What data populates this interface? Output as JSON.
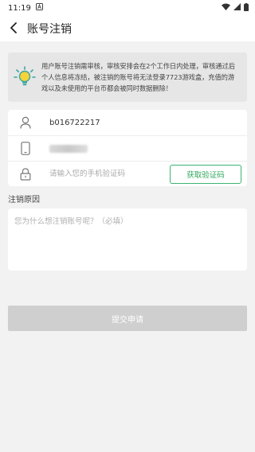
{
  "status_bar": {
    "time": "11:19",
    "notification_icon": "a-letter-icon",
    "wifi_icon": "wifi-icon",
    "signal_icon": "signal-icon",
    "battery_icon": "battery-icon"
  },
  "nav": {
    "back_icon": "chevron-left-icon",
    "title": "账号注销"
  },
  "notice": {
    "icon": "lightbulb-icon",
    "text": "用户账号注销需审核，审核安排会在2个工作日内处理，审核通过后个人信息将冻结，被注销的账号将无法登录7723游戏盒，充值的游戏以及未使用的平台币都会被同时数据删除！"
  },
  "form": {
    "account_icon": "user-icon",
    "account_value": "b016722217",
    "phone_icon": "phone-icon",
    "code_icon": "lock-icon",
    "code_placeholder": "请输入您的手机验证码",
    "code_button_label": "获取验证码"
  },
  "reason": {
    "label": "注销原因",
    "placeholder": "您为什么想注销账号呢？（必填）"
  },
  "submit": {
    "label": "提交申请"
  },
  "colors": {
    "accent_green": "#2ea85c",
    "submit_disabled": "#cfcfcf",
    "page_bg": "#f2f2f2",
    "bulb_yellow": "#f5d33a",
    "bulb_teal": "#3aa6a0"
  }
}
